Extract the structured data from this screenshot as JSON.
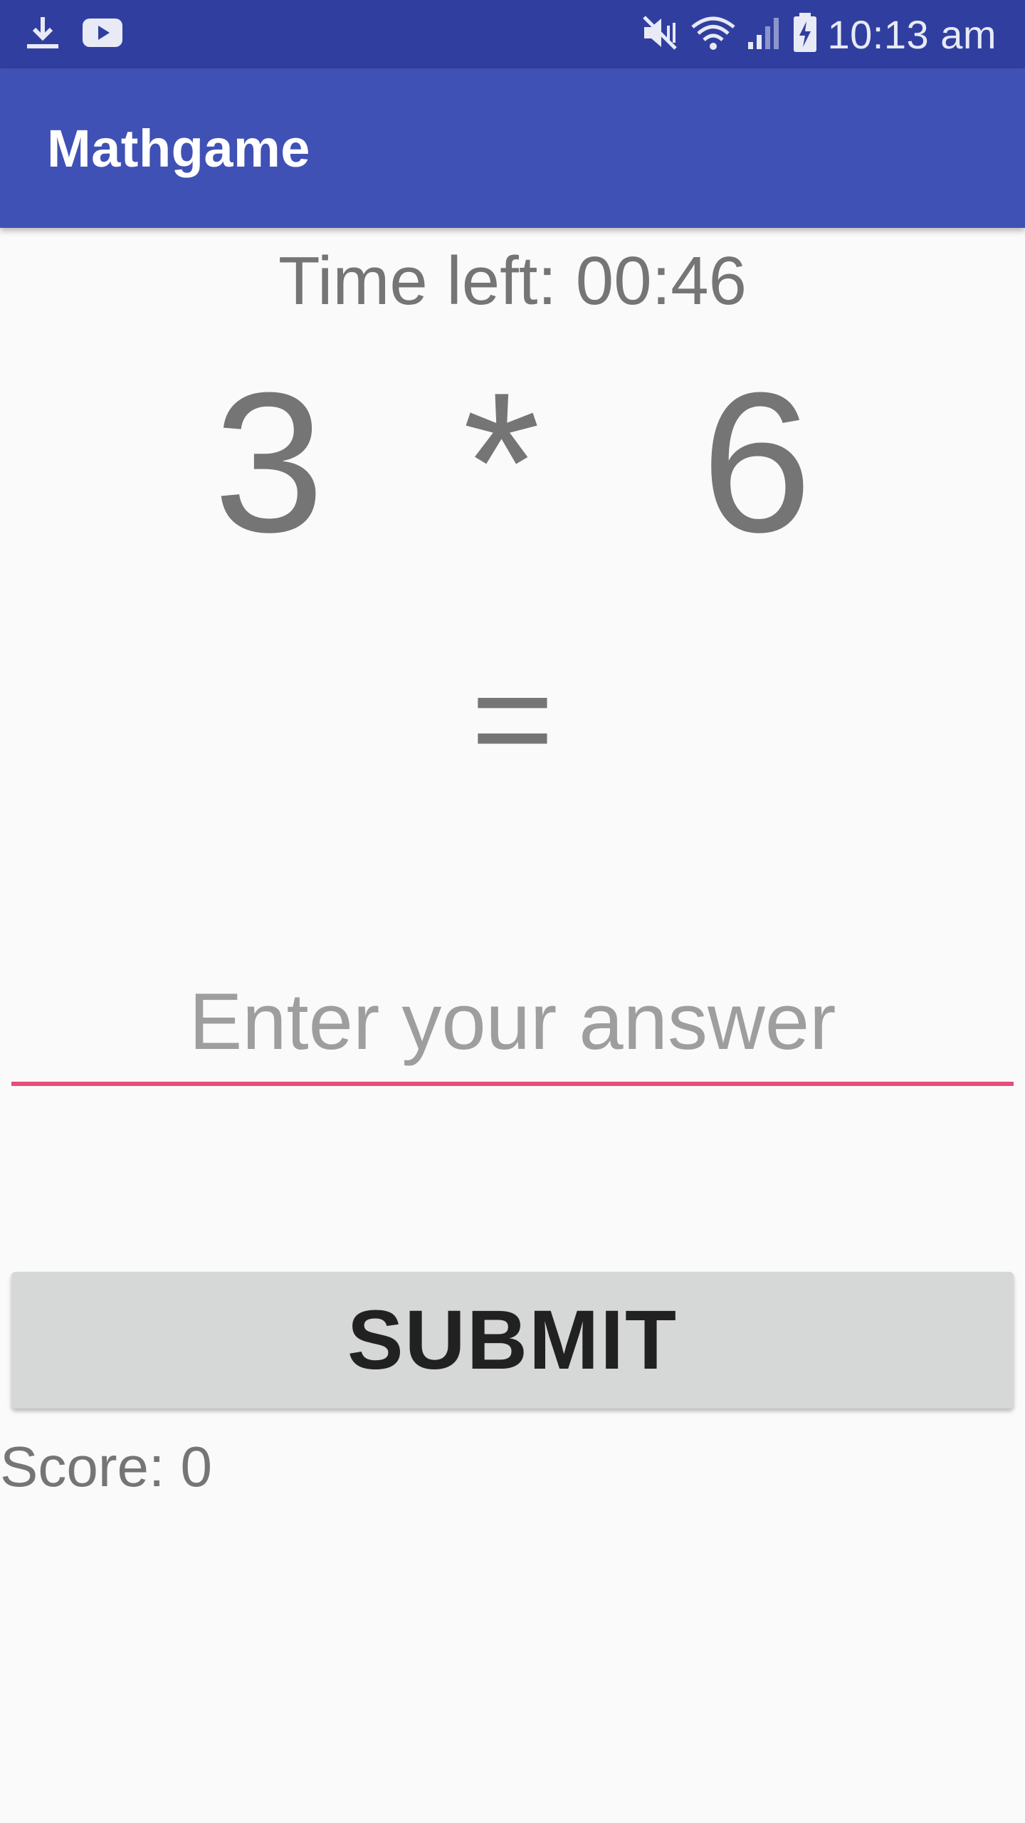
{
  "status_bar": {
    "time": "10:13 am",
    "icons": [
      "download-icon",
      "youtube-icon",
      "mute-icon",
      "wifi-icon",
      "signal-icon",
      "battery-charging-icon"
    ]
  },
  "app_bar": {
    "title": "Mathgame"
  },
  "game": {
    "time_left": "Time left: 00:46",
    "operand1": "3",
    "operator": "*",
    "operand2": "6",
    "equals": "="
  },
  "answer": {
    "placeholder": "Enter your answer",
    "value": ""
  },
  "submit": {
    "label": "SUBMIT"
  },
  "score": {
    "text": "Score: 0"
  },
  "colors": {
    "status_bar": "#303f9f",
    "app_bar": "#3f51b5",
    "accent": "#e84c7a",
    "text_gray": "#757575"
  }
}
